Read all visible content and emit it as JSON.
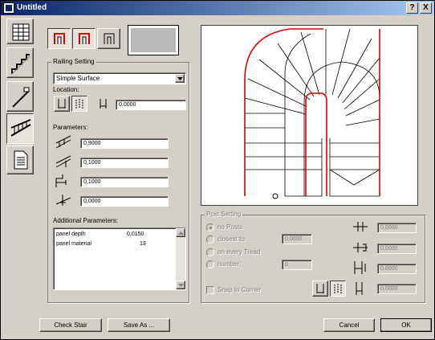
{
  "window": {
    "title": "Untitled",
    "help_label": "?",
    "close_label": "X"
  },
  "railing_setting": {
    "group_label": "Railing Setting",
    "type_value": "Simple Surface",
    "location_label": "Location:",
    "location_value": "0,0000"
  },
  "parameters": {
    "group_label": "Parameters:",
    "values": [
      "0,9000",
      "0,1000",
      "0,1000",
      "0,0000"
    ]
  },
  "additional": {
    "label": "Additional Parameters:",
    "rows": [
      {
        "name": "panel depth",
        "value": "0,0150"
      },
      {
        "name": "panel material",
        "value": "13"
      }
    ]
  },
  "post_setting": {
    "group_label": "Post Setting",
    "options": [
      "no Posts",
      "closest to:",
      "on every Tread",
      "number:"
    ],
    "closest_value": "0,0000",
    "number_value": "0",
    "snap_label": "Snap to Corner",
    "right_values": [
      "0,0000",
      "0,0000",
      "0,0000",
      "0,0000"
    ]
  },
  "buttons": {
    "check_stair": "Check Stair",
    "save_as": "Save As ...",
    "cancel": "Cancel",
    "ok": "OK"
  },
  "colors": {
    "titlebar": "#0a246a",
    "railing": "#e00000",
    "preview_border": "#404040"
  }
}
